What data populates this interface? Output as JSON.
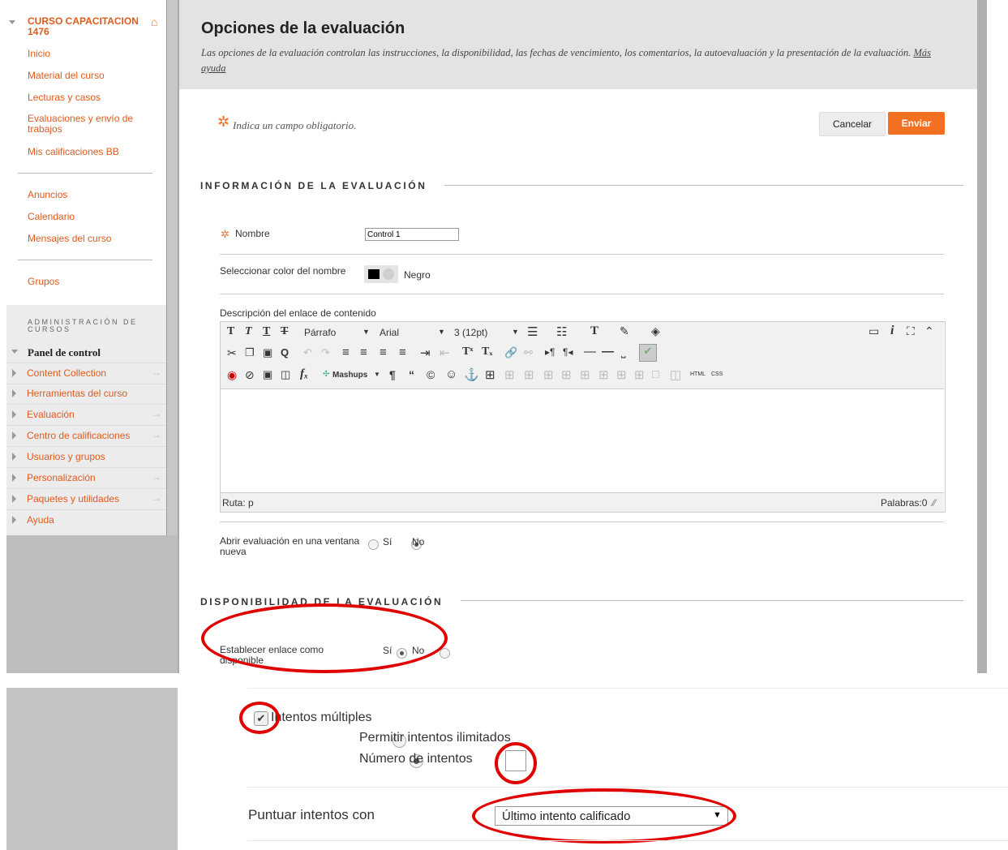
{
  "sidebar": {
    "course_title": "CURSO CAPACITACION 1476",
    "links_top": [
      "Inicio",
      "Material del curso",
      "Lecturas y casos",
      "Evaluaciones y envío de trabajos",
      "Mis calificaciones BB"
    ],
    "links_mid": [
      "Anuncios",
      "Calendario",
      "Mensajes del curso"
    ],
    "links_bot": [
      "Grupos"
    ],
    "admin_title": "ADMINISTRACIÓN DE CURSOS",
    "panel_label": "Panel de control",
    "admin_items": [
      "Content Collection",
      "Herramientas del curso",
      "Evaluación",
      "Centro de calificaciones",
      "Usuarios y grupos",
      "Personalización",
      "Paquetes y utilidades",
      "Ayuda"
    ],
    "arrow_glyph": "→",
    "accent_color": "#e05a1c"
  },
  "header": {
    "title": "Opciones de la evaluación",
    "subtitle": "Las opciones de la evaluación controlan las instrucciones, la disponibilidad, las fechas de vencimiento, los comentarios, la autoevaluación y la presentación de la evaluación.",
    "help_link": "Más ayuda"
  },
  "form": {
    "required_note": "Indica un campo obligatorio.",
    "required_symbol": "✲",
    "cancel_label": "Cancelar",
    "submit_label": "Enviar",
    "submit_color": "#f36f21",
    "section_info": "INFORMACIÓN DE LA EVALUACIÓN",
    "name_label": "Nombre",
    "name_value": "Control 1",
    "color_label": "Seleccionar color del nombre",
    "color_value": "Negro",
    "desc_label": "Descripción del enlace de contenido",
    "editor": {
      "format": "Párrafo",
      "font": "Arial",
      "size": "3 (12pt)",
      "mashups": "Mashups",
      "html": "HTML",
      "css": "CSS",
      "path": "Ruta: p",
      "words": "Palabras:0"
    },
    "new_window_label": "Abrir evaluación en una ventana nueva",
    "yes": "Sí",
    "no": "No",
    "section_avail": "DISPONIBILIDAD DE LA EVALUACIÓN",
    "available_label": "Establecer enlace como disponible"
  },
  "attempts": {
    "multiple_label": "Intentos múltiples",
    "unlimited_label": "Permitir intentos ilimitados",
    "number_label": "Número de intentos",
    "score_label": "Puntuar intentos con",
    "score_value": "Último intento calificado"
  }
}
